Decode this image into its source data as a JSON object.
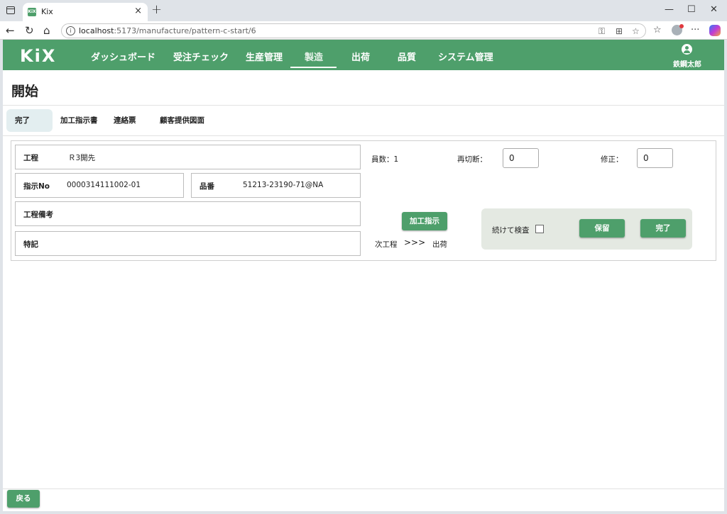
{
  "browser": {
    "tab_title": "Kix",
    "url_host": "localhost",
    "url_path": ":5173/manufacture/pattern-c-start/6",
    "favicon_text": "KiX"
  },
  "header": {
    "logo": "KiX",
    "nav": [
      {
        "label": "ダッシュボード"
      },
      {
        "label": "受注チェック"
      },
      {
        "label": "生産管理"
      },
      {
        "label": "製造"
      },
      {
        "label": "出荷"
      },
      {
        "label": "品質"
      },
      {
        "label": "システム管理"
      }
    ],
    "active_nav": "製造",
    "user_name": "鉄鋼太郎"
  },
  "page": {
    "title": "開始"
  },
  "subtabs": [
    {
      "label": "完了"
    },
    {
      "label": "加工指示書"
    },
    {
      "label": "連絡票"
    },
    {
      "label": "顧客提供図面"
    }
  ],
  "form": {
    "process_label": "工程",
    "process_value": "Ｒ3開先",
    "order_no_label": "指示No",
    "order_no_value": "0000314111002-01",
    "part_no_label": "品番",
    "part_no_value": "51213-23190-71@NA",
    "process_note_label": "工程備考",
    "special_note_label": "特記",
    "count_text": "員数：1",
    "recut_label": "再切断：",
    "recut_value": "0",
    "fix_label": "修正：",
    "fix_value": "0",
    "instruction_button": "加工指示",
    "next_process_label": "次工程",
    "next_process_arrow": ">>>",
    "next_process_value": "出荷",
    "continue_inspect_label": "続けて検査",
    "hold_button": "保留",
    "complete_button": "完了"
  },
  "footer": {
    "back_button": "戻る"
  },
  "colors": {
    "brand": "#4e9f6b",
    "action_box": "#e4e9e2",
    "active_subtab": "#e3eef0"
  }
}
